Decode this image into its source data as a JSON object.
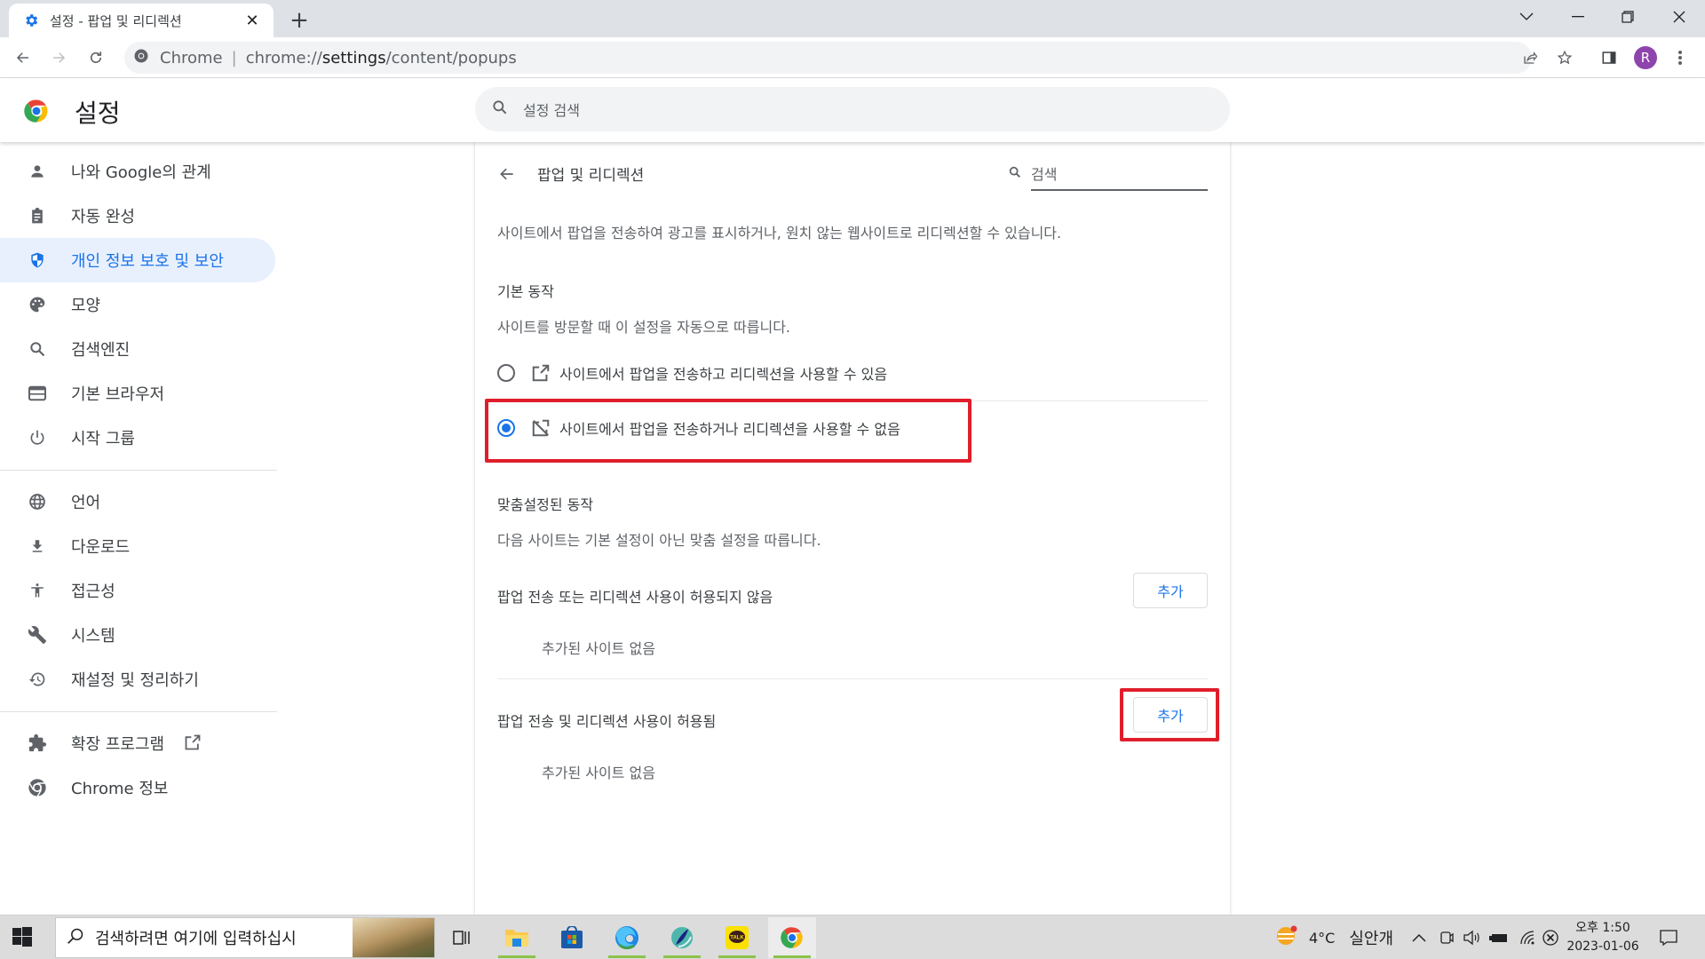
{
  "browser": {
    "tab_title": "설정 - 팝업 및 리디렉션",
    "tab_icon": "gear-icon",
    "new_tab_label": "+",
    "omnibox_chip": "Chrome",
    "omnibox_url_prefix": "chrome://",
    "omnibox_url_host": "settings",
    "omnibox_url_path": "/content/popups",
    "profile_initial": "R"
  },
  "header": {
    "title": "설정",
    "search_placeholder": "설정 검색"
  },
  "sidebar": {
    "items": [
      {
        "label": "나와 Google의 관계",
        "icon": "person-icon"
      },
      {
        "label": "자동 완성",
        "icon": "clipboard-icon"
      },
      {
        "label": "개인 정보 보호 및 보안",
        "icon": "shield-icon",
        "active": true
      },
      {
        "label": "모양",
        "icon": "palette-icon"
      },
      {
        "label": "검색엔진",
        "icon": "search-icon"
      },
      {
        "label": "기본 브라우저",
        "icon": "browser-window-icon"
      },
      {
        "label": "시작 그룹",
        "icon": "power-icon"
      },
      {
        "label": "언어",
        "icon": "globe-icon"
      },
      {
        "label": "다운로드",
        "icon": "download-icon"
      },
      {
        "label": "접근성",
        "icon": "accessibility-icon"
      },
      {
        "label": "시스템",
        "icon": "wrench-icon"
      },
      {
        "label": "재설정 및 정리하기",
        "icon": "restore-icon"
      },
      {
        "label": "확장 프로그램",
        "icon": "puzzle-icon"
      },
      {
        "label": "Chrome 정보",
        "icon": "chrome-icon"
      }
    ]
  },
  "main": {
    "title": "팝업 및 리디렉션",
    "search_placeholder": "검색",
    "description": "사이트에서 팝업을 전송하여 광고를 표시하거나, 원치 않는 웹사이트로 리디렉션할 수 있습니다.",
    "default_behavior": {
      "heading": "기본 동작",
      "subtext": "사이트를 방문할 때 이 설정을 자동으로 따릅니다.",
      "options": [
        {
          "label": "사이트에서 팝업을 전송하고 리디렉션을 사용할 수 있음",
          "icon": "open-in-new-icon",
          "checked": false
        },
        {
          "label": "사이트에서 팝업을 전송하거나 리디렉션을 사용할 수 없음",
          "icon": "popup-blocked-icon",
          "checked": true
        }
      ]
    },
    "custom_behavior": {
      "heading": "맞춤설정된 동작",
      "subtext": "다음 사이트는 기본 설정이 아닌 맞춤 설정을 따릅니다.",
      "lists": [
        {
          "label": "팝업 전송 또는 리디렉션 사용이 허용되지 않음",
          "add_label": "추가",
          "empty_text": "추가된 사이트 없음"
        },
        {
          "label": "팝업 전송 및 리디렉션 사용이 허용됨",
          "add_label": "추가",
          "empty_text": "추가된 사이트 없음"
        }
      ]
    }
  },
  "taskbar": {
    "search_placeholder": "검색하려면 여기에 입력하십시",
    "apps": [
      "task-view",
      "file-explorer",
      "microsoft-store",
      "edge",
      "app-swirl",
      "kakaotalk",
      "chrome"
    ],
    "weather_temp": "4°C",
    "weather_desc": "실안개",
    "time": "오후 1:50",
    "date": "2023-01-06"
  },
  "colors": {
    "accent": "#1a73e8",
    "highlight": "#e01e2b",
    "active_nav_bg": "#e8f0fe"
  }
}
